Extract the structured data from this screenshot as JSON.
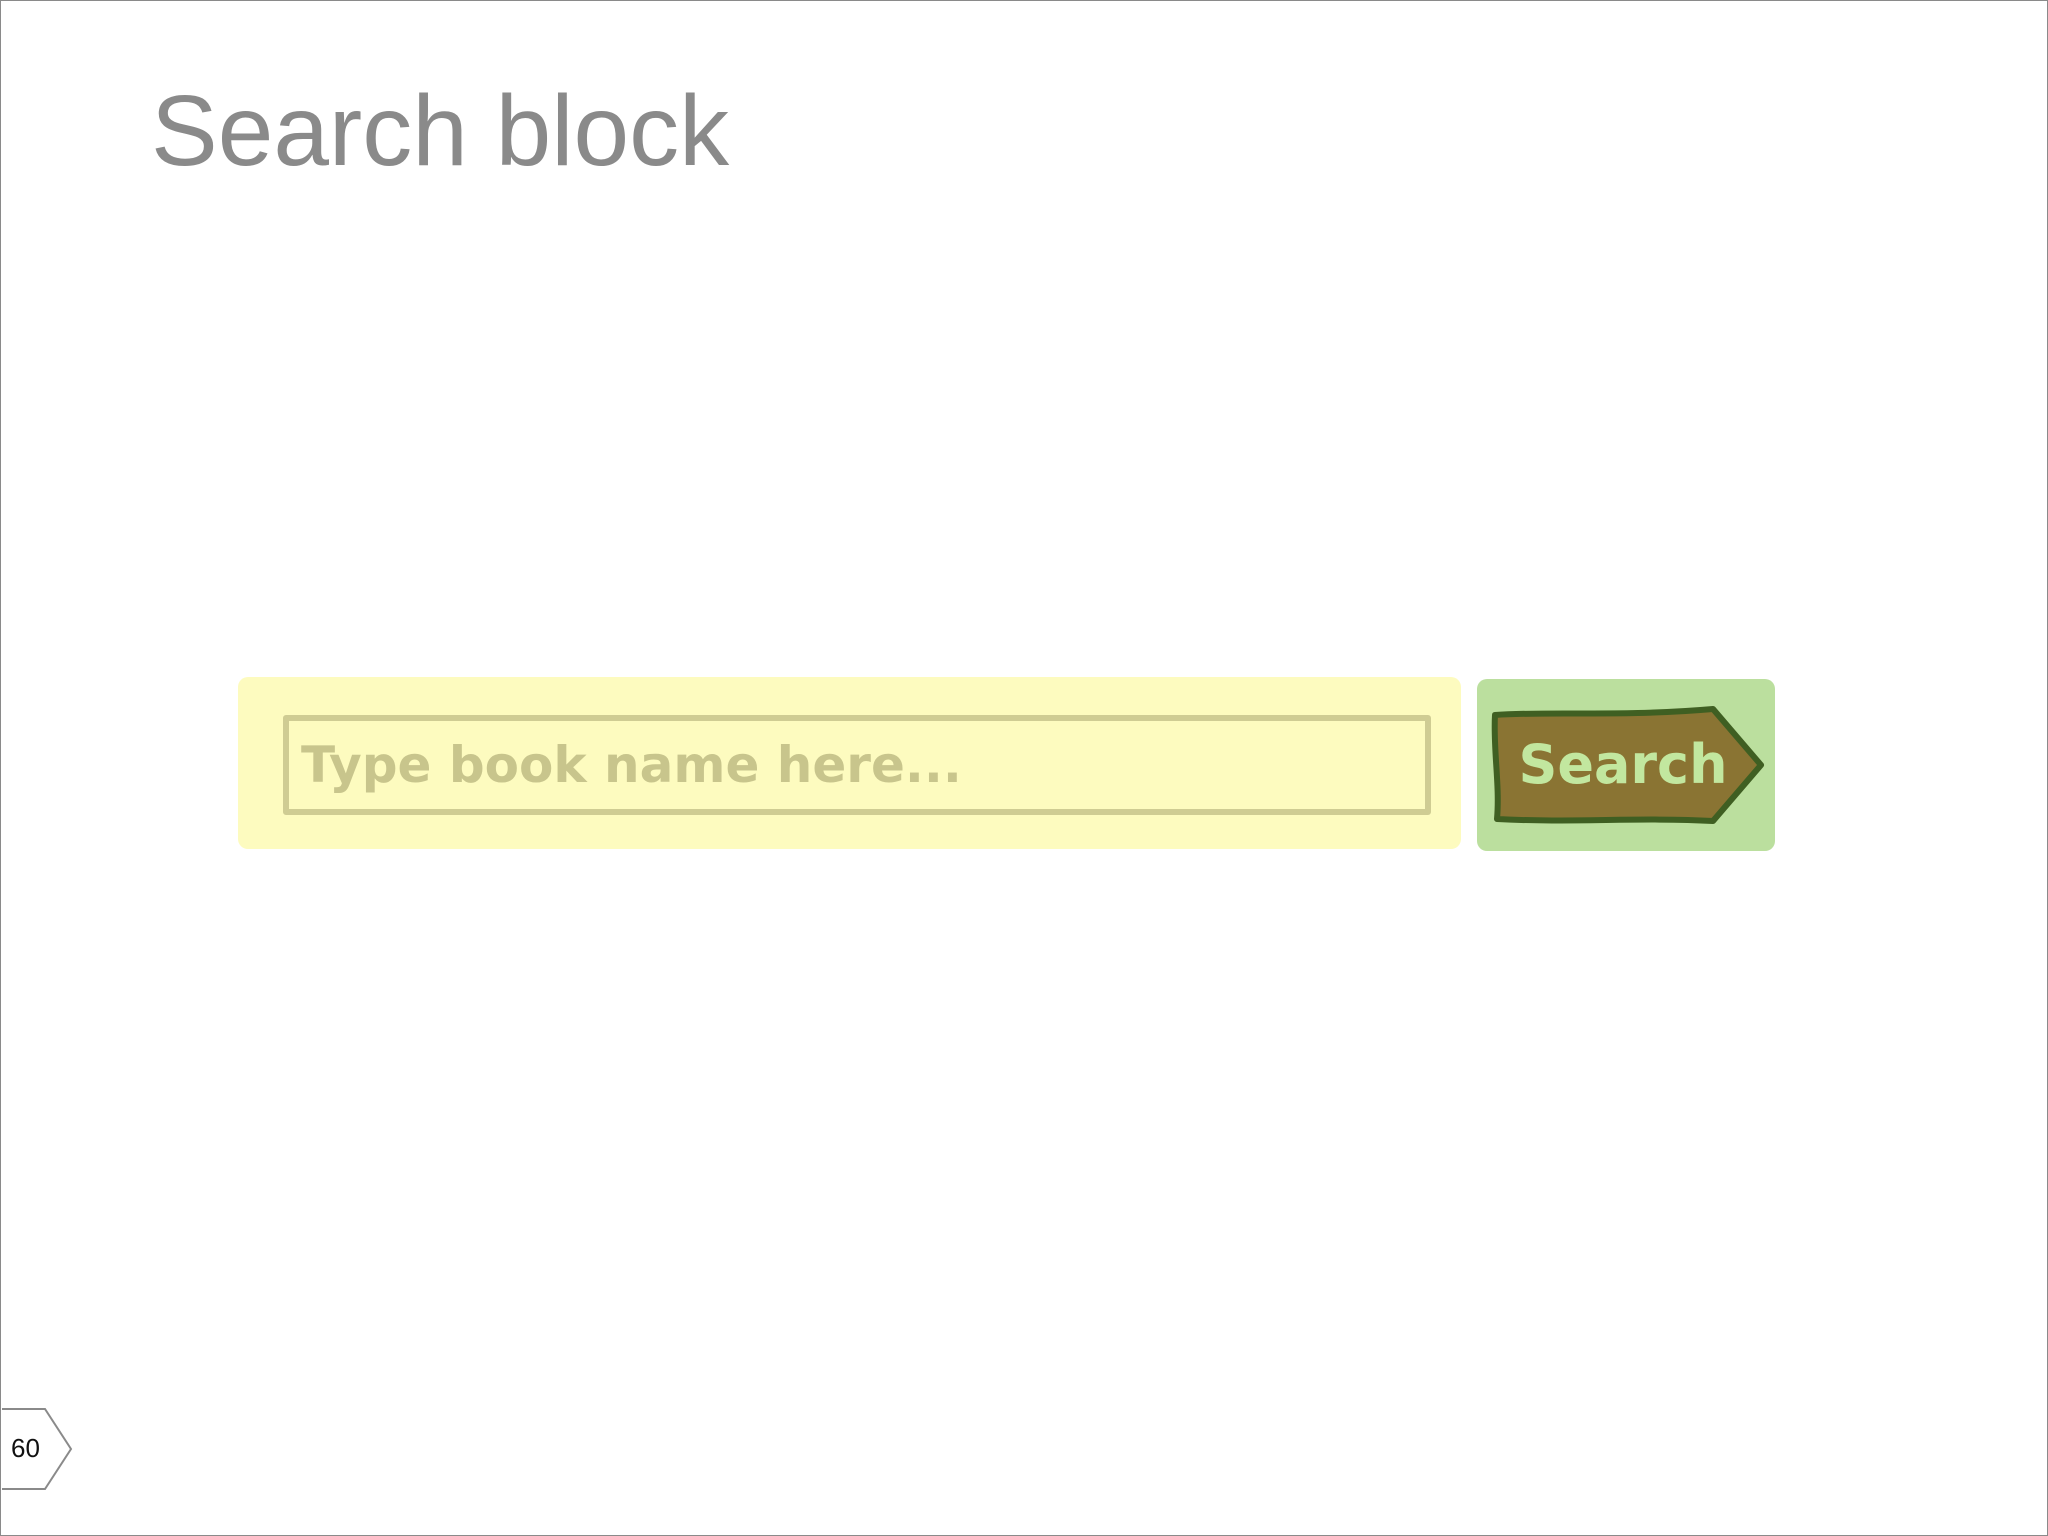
{
  "slide": {
    "title": "Search block",
    "page_number": "60"
  },
  "search": {
    "placeholder": "Type book name here...",
    "value": "",
    "button_label": "Search"
  },
  "colors": {
    "title_text": "#8a8a8a",
    "input_panel_background": "#fdfbbf",
    "input_border": "#cfcc93",
    "input_placeholder": "#c8c58c",
    "button_panel_background": "#bbdf9e",
    "button_fill": "#8a7433",
    "button_outline": "#3f5f22",
    "button_text": "#c2e79f"
  },
  "icons": {
    "page_marker": "pentagon-arrow-icon"
  }
}
